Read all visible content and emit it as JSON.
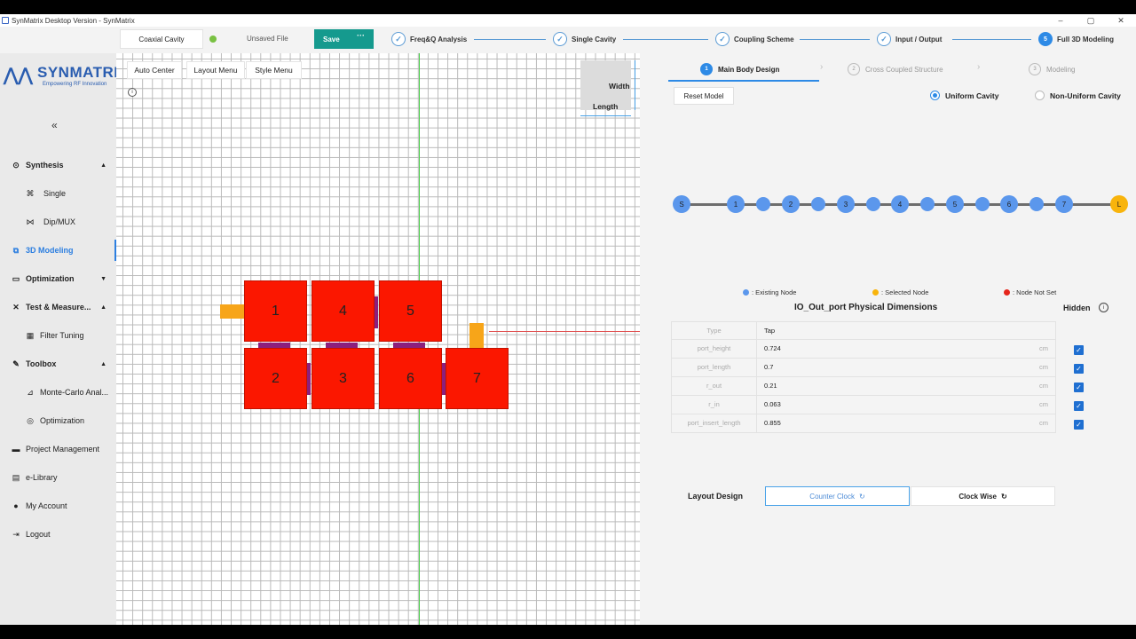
{
  "window": {
    "title": "SynMatrix Desktop Version - SynMatrix",
    "controls": [
      "–",
      "▢",
      "✕"
    ]
  },
  "toolbar": {
    "file_type": "Coaxial Cavity",
    "file_status": "Unsaved File",
    "save_label": "Save",
    "save_more": "···",
    "steps": [
      {
        "label": "Freq&Q Analysis",
        "mark": "✓"
      },
      {
        "label": "Single Cavity",
        "mark": "✓"
      },
      {
        "label": "Coupling Scheme",
        "mark": "✓"
      },
      {
        "label": "Input / Output",
        "mark": "✓"
      },
      {
        "label": "Full 3D Modeling",
        "mark": "5"
      }
    ]
  },
  "sidebar": {
    "logo_name": "SYNMATRIX",
    "logo_tagline": "Empowering RF Innovation",
    "collapse": "«",
    "items": [
      {
        "label": "Synthesis",
        "icon": "synthesis-icon",
        "glyph": "⊙",
        "chevron": "▲"
      },
      {
        "label": "Single",
        "icon": "single-icon",
        "glyph": "⌘"
      },
      {
        "label": "Dip/MUX",
        "icon": "dipmux-icon",
        "glyph": "⋈"
      },
      {
        "label": "3D Modeling",
        "icon": "cube-icon",
        "glyph": "⧉"
      },
      {
        "label": "Optimization",
        "icon": "monitor-icon",
        "glyph": "▭",
        "chevron": "▼"
      },
      {
        "label": "Test & Measure...",
        "icon": "tools-icon",
        "glyph": "✕",
        "chevron": "▲"
      },
      {
        "label": "Filter Tuning",
        "icon": "filter-icon",
        "glyph": "▦"
      },
      {
        "label": "Toolbox",
        "icon": "wrench-icon",
        "glyph": "✎",
        "chevron": "▲"
      },
      {
        "label": "Monte-Carlo Anal...",
        "icon": "chart-icon",
        "glyph": "⊿"
      },
      {
        "label": "Optimization",
        "icon": "target-icon",
        "glyph": "◎"
      },
      {
        "label": "Project Management",
        "icon": "folder-icon",
        "glyph": "▬"
      },
      {
        "label": "e-Library",
        "icon": "book-icon",
        "glyph": "▤"
      },
      {
        "label": "My Account",
        "icon": "user-icon",
        "glyph": "●"
      },
      {
        "label": "Logout",
        "icon": "logout-icon",
        "glyph": "⇥"
      }
    ]
  },
  "canvas": {
    "buttons": [
      "Auto Center",
      "Layout Menu",
      "Style Menu"
    ],
    "info": "i",
    "dim_width": "Width",
    "dim_length": "Length",
    "cavities": [
      "1",
      "4",
      "5",
      "2",
      "3",
      "6",
      "7"
    ],
    "colors": {
      "cavity": "#fb1700",
      "coupler": "#8c1f7d",
      "port": "#f7a519"
    }
  },
  "panel": {
    "steps": [
      {
        "num": "1",
        "label": "Main Body Design"
      },
      {
        "num": "2",
        "label": "Cross Coupled Structure"
      },
      {
        "num": "3",
        "label": "Modeling"
      }
    ],
    "reset_label": "Reset Model",
    "radio_uniform": "Uniform Cavity",
    "radio_nonuniform": "Non-Uniform Cavity",
    "nodes": [
      "S",
      "1",
      "",
      "2",
      "",
      "3",
      "",
      "4",
      "",
      "5",
      "",
      "6",
      "",
      "7",
      "L"
    ],
    "legend": {
      "existing": ": Existing Node",
      "selected": ": Selected Node",
      "not_set": ": Node Not Set"
    },
    "section_title": "IO_Out_port Physical Dimensions",
    "hidden_label": "Hidden",
    "hidden_info": "i",
    "table": [
      {
        "key": "Type",
        "value": "Tap",
        "unit": ""
      },
      {
        "key": "port_height",
        "value": "0.724",
        "unit": "cm"
      },
      {
        "key": "port_length",
        "value": "0.7",
        "unit": "cm"
      },
      {
        "key": "r_out",
        "value": "0.21",
        "unit": "cm"
      },
      {
        "key": "r_in",
        "value": "0.063",
        "unit": "cm"
      },
      {
        "key": "port_insert_length",
        "value": "0.855",
        "unit": "cm"
      }
    ],
    "check": "✓",
    "layout_label": "Layout Design",
    "counter_clock": "Counter Clock",
    "clock_wise": "Clock Wise",
    "spin": "↻",
    "colors": {
      "accent": "#2d8ae6",
      "node": "#5b97ec",
      "selected": "#f8b40c",
      "not_set": "#e5251b"
    }
  }
}
